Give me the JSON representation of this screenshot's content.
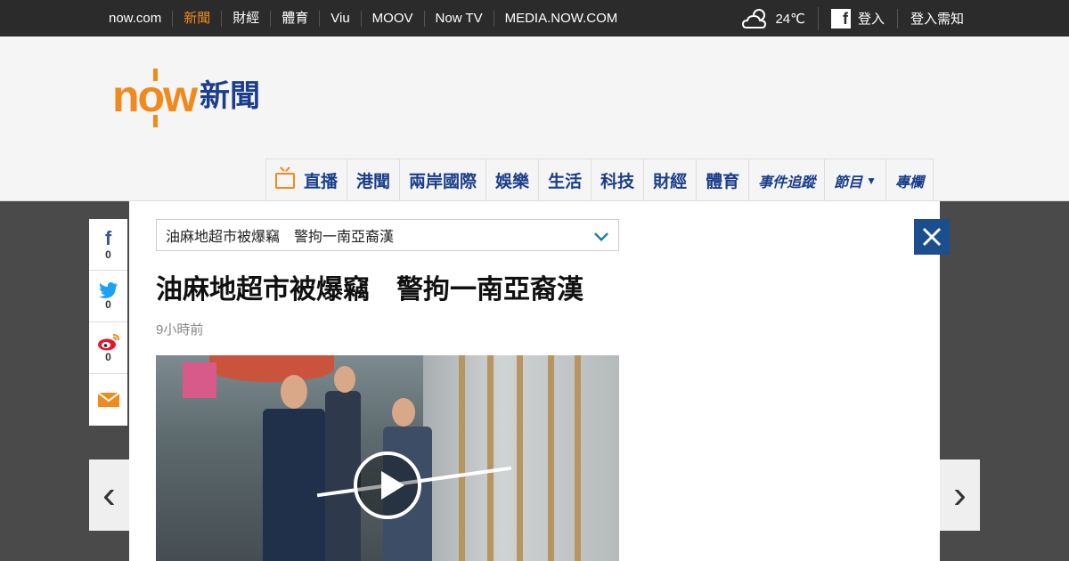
{
  "topbar": {
    "links": [
      "now.com",
      "新聞",
      "財經",
      "體育",
      "Viu",
      "MOOV",
      "Now TV",
      "MEDIA.NOW.COM"
    ],
    "active_index": 1,
    "weather_icon": "cloud-sun-icon",
    "temperature": "24℃",
    "fb_login": "登入",
    "login_help": "登入需知"
  },
  "logo": {
    "brand": "now",
    "suffix": "新聞"
  },
  "mainnav": {
    "items": [
      "直播",
      "港聞",
      "兩岸國際",
      "娛樂",
      "生活",
      "科技",
      "財經",
      "體育",
      "事件追蹤",
      "節目",
      "專欄"
    ]
  },
  "share": {
    "facebook_count": "0",
    "twitter_count": "0",
    "weibo_count": "0"
  },
  "article": {
    "dropdown_value": "油麻地超市被爆竊　警拘一南亞裔漢",
    "title": "油麻地超市被爆竊　警拘一南亞裔漢",
    "time": "9小時前"
  },
  "colors": {
    "accent_orange": "#f08a1c",
    "brand_blue": "#1a3e8c",
    "close_blue": "#1a4e8c"
  }
}
